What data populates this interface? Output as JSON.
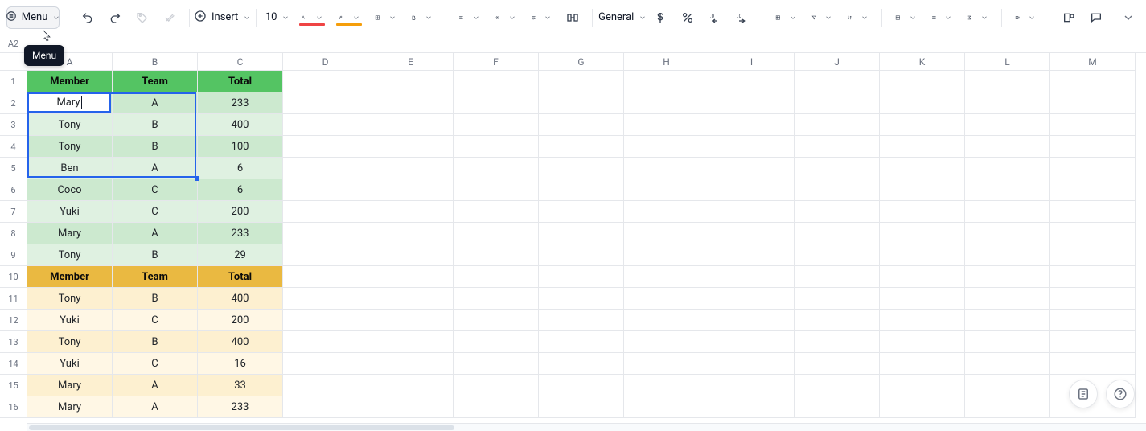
{
  "toolbar": {
    "menu_label": "Menu",
    "insert_label": "Insert",
    "font_size": "10",
    "number_format_label": "General",
    "tooltip_menu": "Menu"
  },
  "colors": {
    "font_underline": "#ef4444",
    "highlight_underline": "#f59e0b",
    "selection_border": "#2563eb"
  },
  "name_box": "A2",
  "columns": [
    "A",
    "B",
    "C",
    "D",
    "E",
    "F",
    "G",
    "H",
    "I",
    "J",
    "K",
    "L",
    "M"
  ],
  "rows_visible": 16,
  "selection": {
    "from": "A2",
    "to": "B5",
    "active": "A2",
    "active_value": "Mary"
  },
  "grid": {
    "row_styles": {
      "1": "hdr-green",
      "2": "green-a",
      "3": "green-b",
      "4": "green-a",
      "5": "green-b",
      "6": "green-a",
      "7": "green-b",
      "8": "green-a",
      "9": "green-b",
      "10": "hdr-yellow",
      "11": "yellow-a",
      "12": "yellow-b",
      "13": "yellow-a",
      "14": "yellow-b",
      "15": "yellow-a",
      "16": "yellow-b"
    },
    "cells": {
      "A1": "Member",
      "B1": "Team",
      "C1": "Total",
      "A2": "Mary",
      "B2": "A",
      "C2": "233",
      "A3": "Tony",
      "B3": "B",
      "C3": "400",
      "A4": "Tony",
      "B4": "B",
      "C4": "100",
      "A5": "Ben",
      "B5": "A",
      "C5": "6",
      "A6": "Coco",
      "B6": "C",
      "C6": "6",
      "A7": "Yuki",
      "B7": "C",
      "C7": "200",
      "A8": "Mary",
      "B8": "A",
      "C8": "233",
      "A9": "Tony",
      "B9": "B",
      "C9": "29",
      "A10": "Member",
      "B10": "Team",
      "C10": "Total",
      "A11": "Tony",
      "B11": "B",
      "C11": "400",
      "A12": "Yuki",
      "B12": "C",
      "C12": "200",
      "A13": "Tony",
      "B13": "B",
      "C13": "400",
      "A14": "Yuki",
      "B14": "C",
      "C14": "16",
      "A15": "Mary",
      "B15": "A",
      "C15": "33",
      "A16": "Mary",
      "B16": "A",
      "C16": "233"
    }
  }
}
